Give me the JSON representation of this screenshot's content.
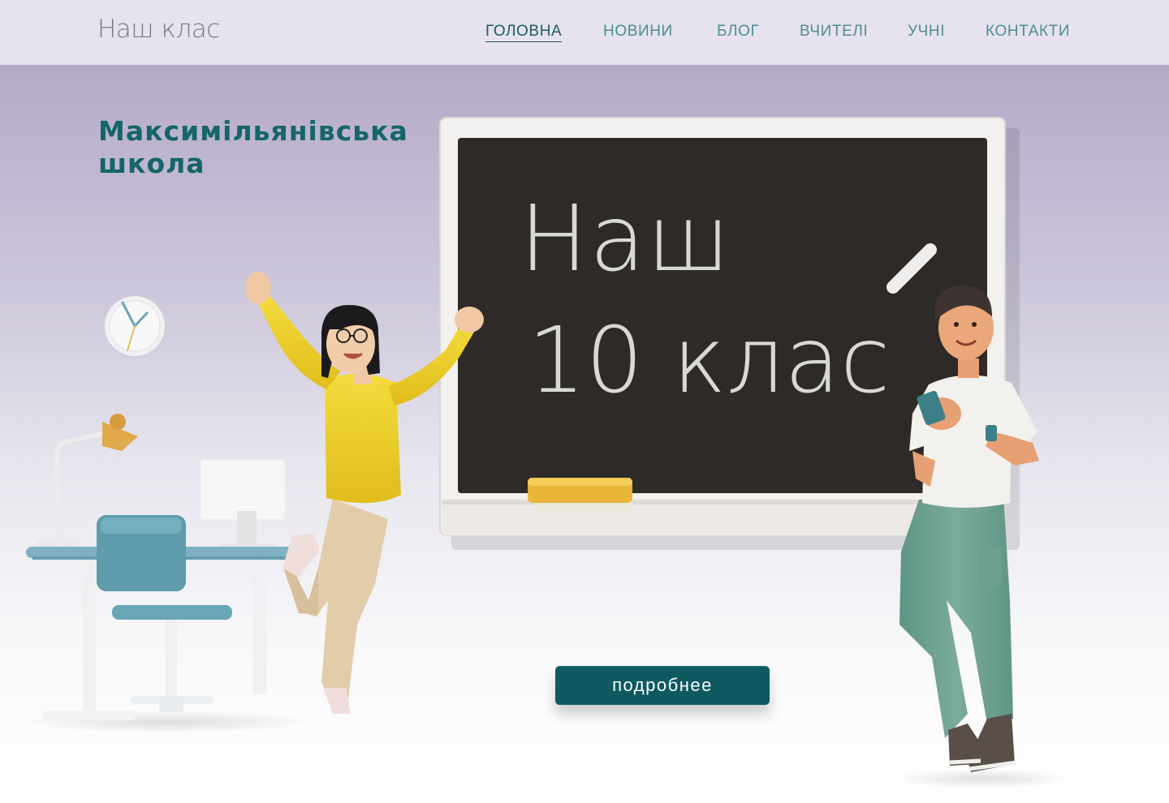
{
  "header": {
    "logo": "Наш клас",
    "nav": [
      "ГОЛОВНА",
      "НОВИНИ",
      "БЛОГ",
      "ВЧИТЕЛІ",
      "УЧНІ",
      "КОНТАКТИ"
    ],
    "active_nav": "ГОЛОВНА"
  },
  "hero": {
    "school_title": "Максимільянівська школа",
    "board_line1": "Наш",
    "board_line2": "10 клас",
    "cta_label": "подробнее"
  },
  "colors": {
    "accent": "#0e5a60",
    "nav_text": "#4d8d92",
    "board": "#2d2a27",
    "header_bg": "#e6e3ee"
  }
}
